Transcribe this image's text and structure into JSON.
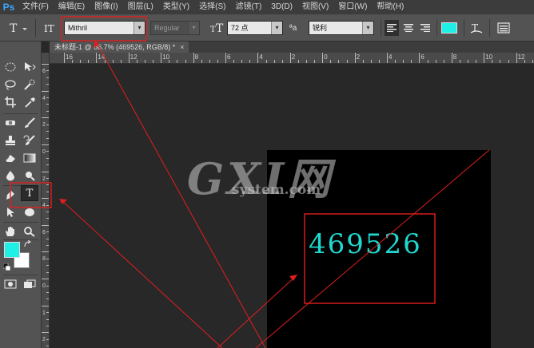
{
  "app": {
    "logo": "Ps"
  },
  "menubar": {
    "items": [
      "文件(F)",
      "编辑(E)",
      "图像(I)",
      "图层(L)",
      "类型(Y)",
      "选择(S)",
      "滤镜(T)",
      "3D(D)",
      "视图(V)",
      "窗口(W)",
      "帮助(H)"
    ]
  },
  "options": {
    "tool_icon": "text-tool-icon",
    "font_family": "Mithril",
    "font_style": "Regular",
    "font_size": "72 点",
    "aa_label": "ªa",
    "antialias": "锐利",
    "text_color": "#1ef0e6",
    "dropdown_arrow": "▾"
  },
  "document": {
    "tab_title": "未标题-1 @ 66.7% (469526, RGB/8) *",
    "close": "×",
    "text_layer_content": "469526",
    "text_color": "#1fd8d0",
    "background": "#000000"
  },
  "ruler": {
    "h_labels": [
      "16",
      "14",
      "12",
      "10",
      "8",
      "6",
      "4",
      "2",
      "0",
      "2",
      "4",
      "6",
      "8",
      "10",
      "12"
    ],
    "v_labels": [
      "6",
      "4",
      "2",
      "0",
      "2",
      "4",
      "6",
      "8",
      "0",
      "1",
      "2"
    ]
  },
  "toolbox": {
    "foreground_color": "#1ef0e6",
    "background_color": "#ffffff",
    "active_tool_label": "T"
  },
  "watermark": {
    "logo": "GXI网",
    "text": "system.com"
  },
  "annotation_color": "#e01e1e"
}
